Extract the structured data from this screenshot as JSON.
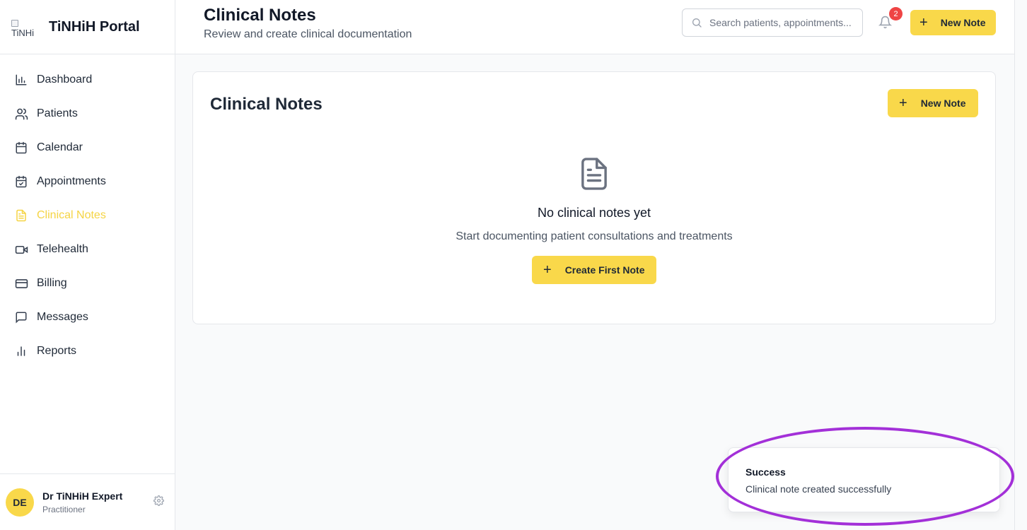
{
  "brand": {
    "logo_alt": "TiNHi",
    "name": "TiNHiH Portal"
  },
  "sidebar": {
    "items": [
      {
        "label": "Dashboard",
        "icon": "bar-chart-icon",
        "active": false
      },
      {
        "label": "Patients",
        "icon": "users-icon",
        "active": false
      },
      {
        "label": "Calendar",
        "icon": "calendar-icon",
        "active": false
      },
      {
        "label": "Appointments",
        "icon": "calendar-check-icon",
        "active": false
      },
      {
        "label": "Clinical Notes",
        "icon": "file-text-icon",
        "active": true
      },
      {
        "label": "Telehealth",
        "icon": "video-icon",
        "active": false
      },
      {
        "label": "Billing",
        "icon": "credit-card-icon",
        "active": false
      },
      {
        "label": "Messages",
        "icon": "message-square-icon",
        "active": false
      },
      {
        "label": "Reports",
        "icon": "bar-chart-2-icon",
        "active": false
      }
    ],
    "active_color": "#f5d443"
  },
  "user": {
    "initials": "DE",
    "name": "Dr TiNHiH Expert",
    "role": "Practitioner"
  },
  "header": {
    "title": "Clinical Notes",
    "subtitle": "Review and create clinical documentation",
    "search_placeholder": "Search patients, appointments...",
    "notification_count": "2",
    "new_note_label": "New Note"
  },
  "card": {
    "title": "Clinical Notes",
    "new_note_label": "New Note",
    "empty_title": "No clinical notes yet",
    "empty_subtitle": "Start documenting patient consultations and treatments",
    "create_first_label": "Create First Note"
  },
  "toast": {
    "title": "Success",
    "message": "Clinical note created successfully"
  },
  "colors": {
    "accent": "#f9d84a",
    "badge": "#ef4444",
    "highlight": "#a330d8"
  }
}
